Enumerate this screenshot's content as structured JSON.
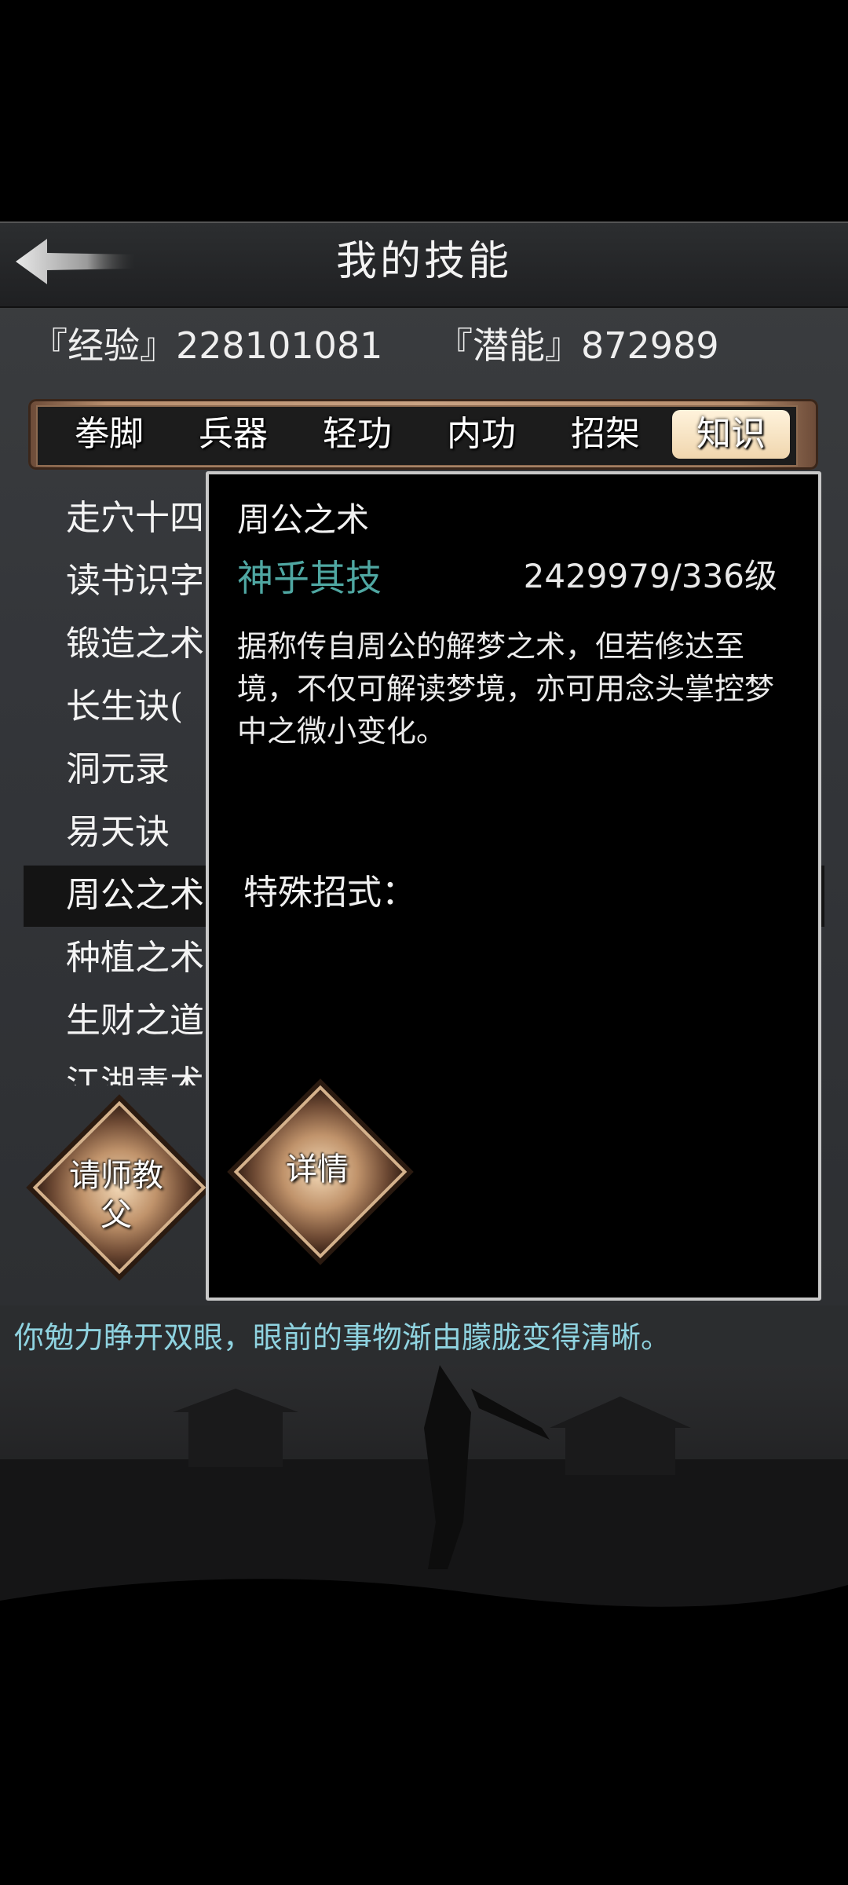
{
  "header": {
    "title": "我的技能"
  },
  "stats": {
    "experience": "『经验』228101081",
    "potential": "『潜能』872989"
  },
  "tabs": [
    {
      "label": "拳脚",
      "active": false
    },
    {
      "label": "兵器",
      "active": false
    },
    {
      "label": "轻功",
      "active": false
    },
    {
      "label": "内功",
      "active": false
    },
    {
      "label": "招架",
      "active": false
    },
    {
      "label": "知识",
      "active": true
    }
  ],
  "skills": [
    "走穴十四",
    "读书识字",
    "锻造之术",
    "长生诀(",
    "洞元录",
    "易天诀",
    "周公之术",
    "种植之术",
    "生财之道",
    "江湖毒术"
  ],
  "detail": {
    "name": "周公之术",
    "rank": "神乎其技",
    "level": "2429979/336级",
    "description": "据称传自周公的解梦之术，但若修达至境，不仅可解读梦境，亦可用念头掌控梦中之微小变化。",
    "special_label": "特殊招式："
  },
  "buttons": {
    "detail": "详情",
    "teacher": "请师教父"
  },
  "message": "你勉力睁开双眼，眼前的事物渐由朦胧变得清晰。",
  "colors": {
    "rank": "#4fa7a2",
    "message": "#8fd3e0",
    "tab_active": "#f0d6ae"
  }
}
